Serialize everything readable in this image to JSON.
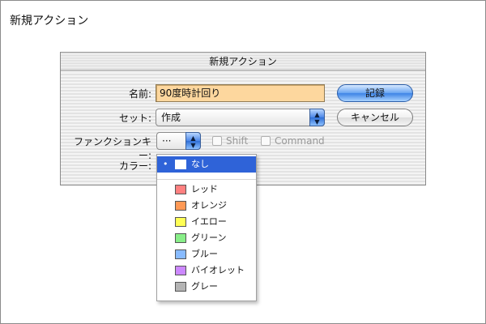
{
  "page": {
    "title": "新規アクション"
  },
  "dialog": {
    "title": "新規アクション",
    "name": {
      "label": "名前:",
      "value": "90度時計回り"
    },
    "set": {
      "label": "セット:",
      "value": "作成"
    },
    "function_key": {
      "label": "ファンクションキー:",
      "value": "···"
    },
    "shift": {
      "label": "Shift",
      "checked": false
    },
    "command": {
      "label": "Command",
      "checked": false
    },
    "color": {
      "label": "カラー:"
    },
    "record_button": "記録",
    "cancel_button": "キャンセル"
  },
  "color_menu": {
    "selected": "なし",
    "selected_marker": "•",
    "items": [
      {
        "label": "なし",
        "color": "#ffffff"
      },
      {
        "label": "レッド",
        "color": "#ff8080"
      },
      {
        "label": "オレンジ",
        "color": "#ff9955"
      },
      {
        "label": "イエロー",
        "color": "#ffff55"
      },
      {
        "label": "グリーン",
        "color": "#88ee88"
      },
      {
        "label": "ブルー",
        "color": "#88bbff"
      },
      {
        "label": "バイオレット",
        "color": "#cc88ff"
      },
      {
        "label": "グレー",
        "color": "#b4b4b4"
      }
    ]
  }
}
